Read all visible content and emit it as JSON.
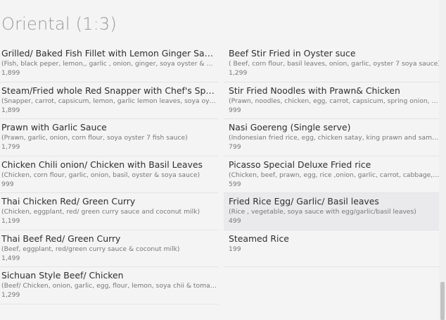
{
  "section": {
    "title": "Oriental (1:3)"
  },
  "left_items": [
    {
      "name": "Grilled/ Baked Fish Fillet with Lemon Ginger Sauce",
      "desc": "(Fish, black peper, lemon,, garlic , onion, ginger, soya oyster & fish ...",
      "price": "1,899"
    },
    {
      "name": "Steam/Fried whole Red Snapper with Chef's Special...",
      "desc": "(Snapper, carrot, capsicum, lemon, garlic lemon leaves, soya oyster ...",
      "price": "1,899"
    },
    {
      "name": "Prawn with Garlic Sauce",
      "desc": "(Prawn, garlic, onion, corn flour, soya oyster 7 fish sauce)",
      "price": "1,799"
    },
    {
      "name": "Chicken Chili onion/ Chicken with Basil Leaves",
      "desc": "(Chicken, corn flour, garlic, onion, basil, oyster & soya sauce)",
      "price": "999"
    },
    {
      "name": "Thai Chicken Red/ Green Curry",
      "desc": "(Chicken, eggplant, red/ green curry sauce and coconut milk)",
      "price": "1,199"
    },
    {
      "name": "Thai Beef Red/ Green Curry",
      "desc": "(Beef, eggplant, red/green curry sauce & coconut milk)",
      "price": "1,499"
    },
    {
      "name": "Sichuan Style Beef/ Chicken",
      "desc": "(Beef/ Chicken, onion, garlic, egg, flour, lemon, soya chii & tomato s...",
      "price": "1,299"
    }
  ],
  "right_items": [
    {
      "name": "Beef Stir Fried in Oyster suce",
      "desc": "( Beef, corn flour, basil leaves, onion, garlic, oyster 7 soya sauce)",
      "price": "1,299"
    },
    {
      "name": "Stir Fried Noodles with Prawn& Chicken",
      "desc": "(Prawn, noodles, chicken, egg, carrot, capsicum, spring onion, cabba...",
      "price": "999"
    },
    {
      "name": "Nasi Goereng (Single serve)",
      "desc": "(Indonesian fried rice, egg, chicken satay, king prawn and sambal ole...",
      "price": "799"
    },
    {
      "name": "Picasso Special Deluxe Fried rice",
      "desc": "(Chicken, beef, prawn, egg, rice ,onion, garlic, carrot, cabbage, white...",
      "price": "599"
    },
    {
      "name": "Fried Rice Egg/ Garlic/ Basil leaves",
      "desc": "(Rice , vegetable, soya sauce with egg/garlic/basil leaves)",
      "price": "499"
    },
    {
      "name": "Steamed Rice",
      "desc": "",
      "price": "199"
    }
  ]
}
